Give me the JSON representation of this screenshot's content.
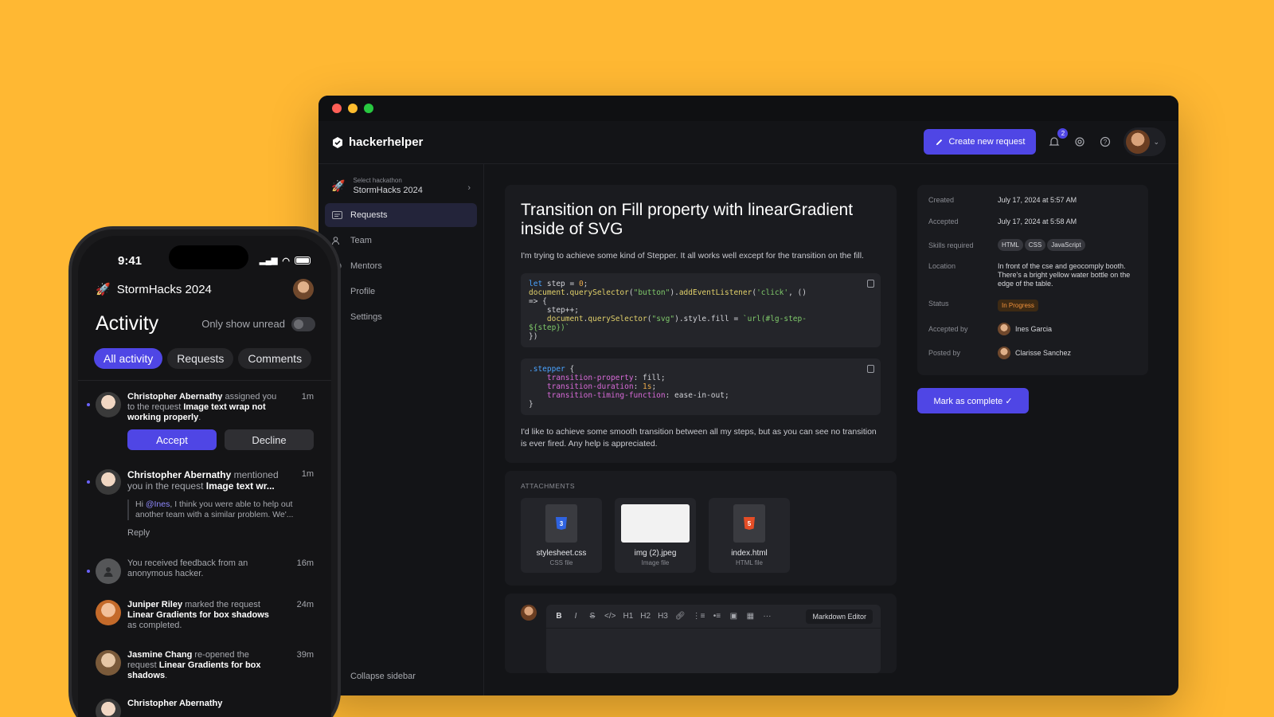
{
  "window": {
    "brand": "hackerhelper",
    "create_button": "Create new request",
    "notification_count": "2",
    "sidebar": {
      "hackathon_label": "Select hackathon",
      "hackathon_name": "StormHacks 2024",
      "items": [
        {
          "label": "Requests",
          "icon": "requests-icon"
        },
        {
          "label": "Team",
          "icon": "team-icon"
        },
        {
          "label": "Mentors",
          "icon": "mentors-icon"
        },
        {
          "label": "Profile",
          "icon": "profile-icon"
        },
        {
          "label": "Settings",
          "icon": "settings-icon"
        }
      ],
      "collapse": "Collapse sidebar"
    },
    "request": {
      "title": "Transition on Fill property with linearGradient inside of SVG",
      "intro": "I'm trying to achieve some kind of Stepper. It all works well except for the transition on the fill.",
      "outro": "I'd like to achieve some smooth transition between all my steps, but as you can see no transition is ever fired. Any help is appreciated."
    },
    "attachments": {
      "label": "ATTACHMENTS",
      "files": [
        {
          "name": "stylesheet.css",
          "type": "CSS file"
        },
        {
          "name": "img (2).jpeg",
          "type": "Image file"
        },
        {
          "name": "index.html",
          "type": "HTML file"
        }
      ]
    },
    "editor": {
      "tools": [
        "B",
        "I",
        "S",
        "</>",
        "H1",
        "H2",
        "H3",
        "link",
        "ol",
        "ul",
        "img",
        "table",
        "···"
      ],
      "mode_button": "Markdown Editor"
    },
    "meta": {
      "created_label": "Created",
      "created": "July 17, 2024 at 5:57 AM",
      "accepted_label": "Accepted",
      "accepted": "July 17, 2024 at 5:58 AM",
      "skills_label": "Skills required",
      "skills": [
        "HTML",
        "CSS",
        "JavaScript"
      ],
      "location_label": "Location",
      "location": "In front of the cse and geocomply booth. There's a bright yellow water bottle on the edge of the table.",
      "status_label": "Status",
      "status": "In Progress",
      "accepted_by_label": "Accepted by",
      "accepted_by": "Ines Garcia",
      "posted_by_label": "Posted by",
      "posted_by": "Clarisse Sanchez"
    },
    "complete_button": "Mark as complete",
    "colors": {
      "accent": "#4F46E5",
      "background": "#FFB833",
      "status": "#F0913A"
    }
  },
  "phone": {
    "time": "9:41",
    "hackathon": "StormHacks 2024",
    "title": "Activity",
    "unread_toggle": "Only show unread",
    "tabs": [
      "All activity",
      "Requests",
      "Comments"
    ],
    "feed": [
      {
        "actor": "Christopher Abernathy",
        "verb": " assigned you to the request ",
        "target": "Image text wrap not working properly",
        "suffix": ".",
        "time": "1m",
        "accept": "Accept",
        "decline": "Decline"
      },
      {
        "actor": "Christopher Abernathy",
        "verb": " mentioned you in the request ",
        "target": "Image text wr...",
        "suffix": "",
        "time": "1m",
        "quote_pre": "Hi ",
        "mention": "@Ines",
        "quote_post": ", I think you were able to help out another team with a similar problem. We'...",
        "reply": "Reply"
      },
      {
        "text": "You received feedback from an anonymous hacker.",
        "time": "16m"
      },
      {
        "actor": "Juniper Riley",
        "verb": " marked the request ",
        "target": "Linear Gradients for box shadows",
        "suffix": " as completed.",
        "time": "24m"
      },
      {
        "actor": "Jasmine Chang",
        "verb": " re-opened the request ",
        "target": "Linear Gradients for box shadows",
        "suffix": ".",
        "time": "39m"
      },
      {
        "actor": "Christopher Abernathy"
      }
    ]
  }
}
